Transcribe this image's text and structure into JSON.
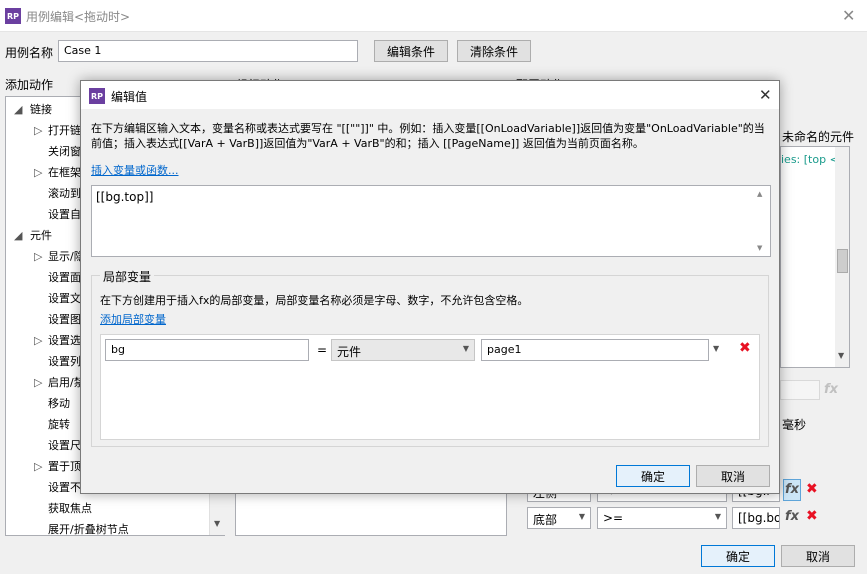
{
  "window": {
    "title": "用例编辑<拖动时>"
  },
  "case_name": {
    "label": "用例名称",
    "value": "Case 1"
  },
  "buttons": {
    "edit_condition": "编辑条件",
    "clear_condition": "清除条件",
    "ok": "确定",
    "cancel": "取消"
  },
  "panels": {
    "add_action": "添加动作",
    "organize_action": "组织动作",
    "configure_action": "配置动作"
  },
  "tree": {
    "groups": [
      {
        "label": "链接",
        "items": [
          "打开链接",
          "关闭窗口",
          "在框架中打开链接",
          "滚动到元件<锚链接>",
          "设置自适应视图"
        ]
      },
      {
        "label": "元件",
        "items": [
          "显示/隐藏",
          "设置面板状态",
          "设置文本",
          "设置图片",
          "设置选中",
          "设置列表选中项",
          "启用/禁用",
          "移动",
          "旋转",
          "设置尺寸",
          "置于顶层/底层",
          "设置不透明",
          "获取焦点",
          "展开/折叠树节点"
        ]
      }
    ]
  },
  "right_panel": {
    "unnamed_element": "未命名的元件",
    "ms_label": "毫秒",
    "row1": {
      "target": "左侧",
      "op": "<=",
      "value": "[[bg.l"
    },
    "row2": {
      "target": "底部",
      "op": ">=",
      "value": "[[bg.bott"
    },
    "code_snippet": "ies: [top <="
  },
  "dialog": {
    "title": "编辑值",
    "instruction": "在下方编辑区输入文本，变量名称或表达式要写在 \"[[\"\"]]\" 中。例如：插入变量[[OnLoadVariable]]返回值为变量\"OnLoadVariable\"的当前值；插入表达式[[VarA + VarB]]返回值为\"VarA + VarB\"的和；插入 [[PageName]] 返回值为当前页面名称。",
    "insert_link": "插入变量或函数...",
    "editor_value": "[[bg.top]]",
    "local_vars": {
      "legend": "局部变量",
      "description": "在下方创建用于插入fx的局部变量，局部变量名称必须是字母、数字，不允许包含空格。",
      "add_link": "添加局部变量",
      "row": {
        "name": "bg",
        "eq": "=",
        "type": "元件",
        "target": "page1"
      }
    },
    "ok": "确定",
    "cancel": "取消"
  }
}
